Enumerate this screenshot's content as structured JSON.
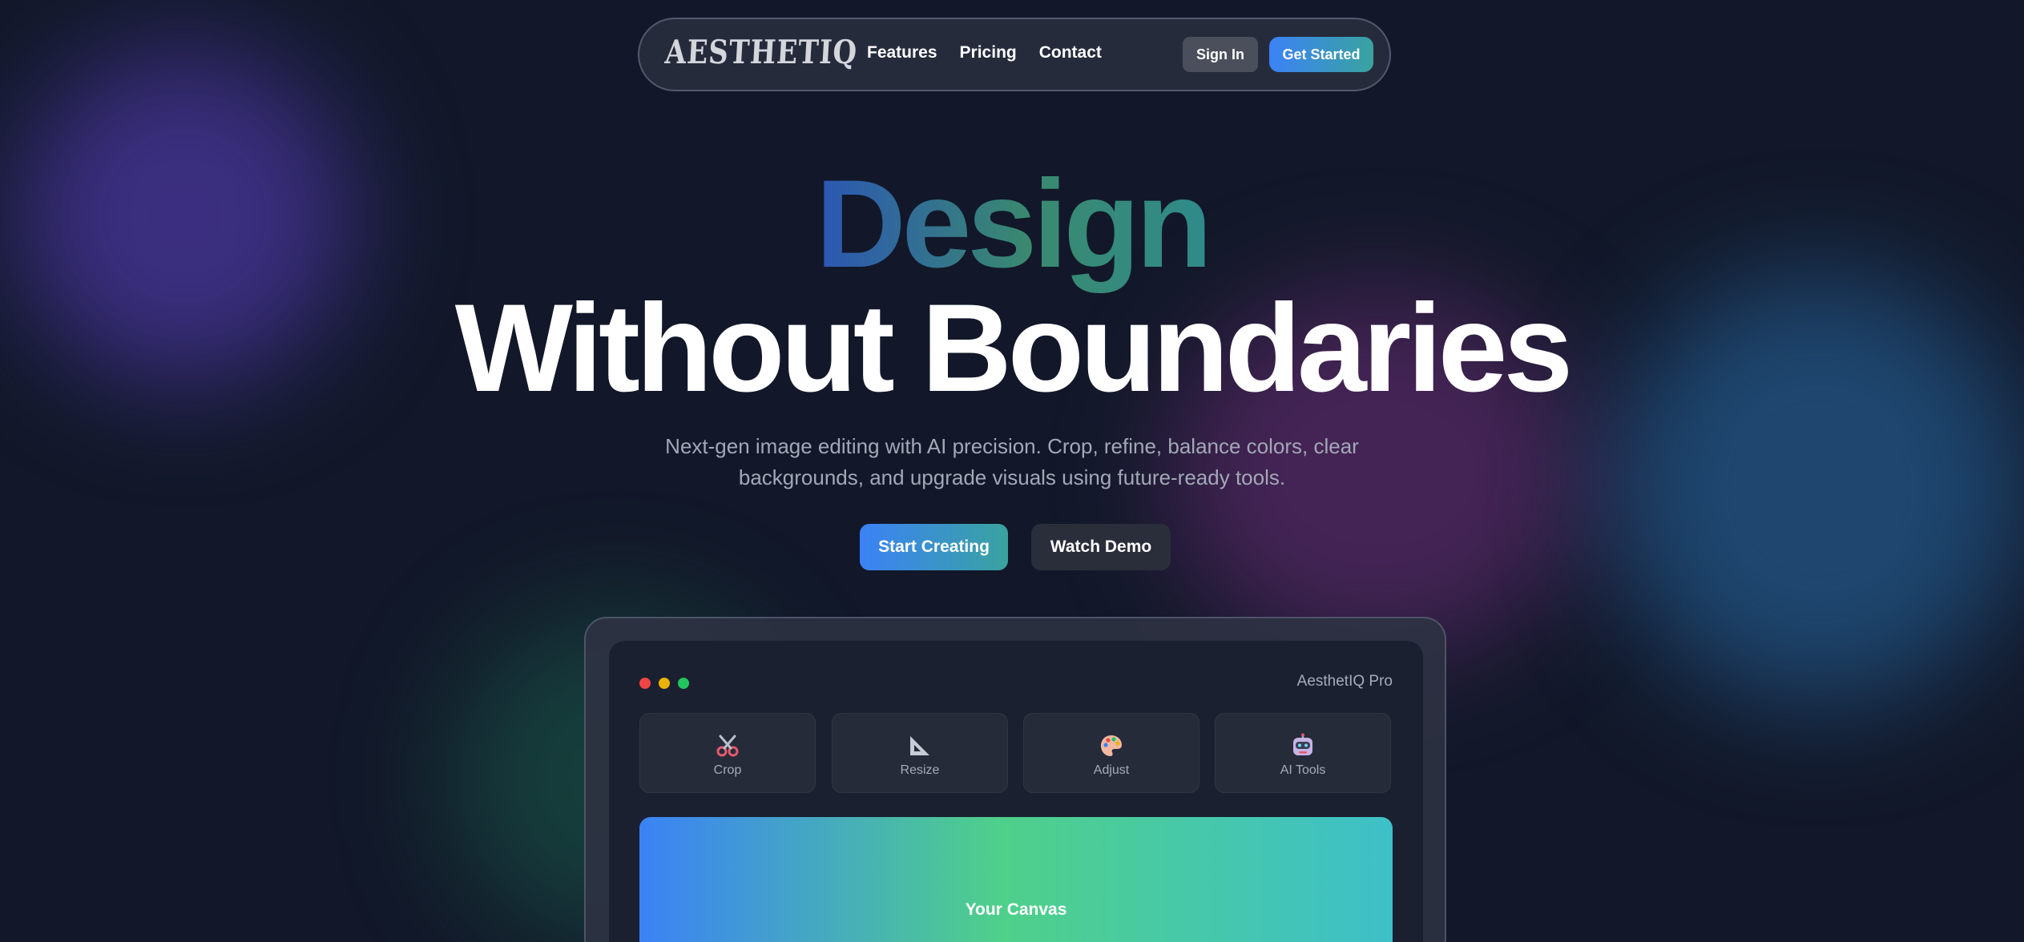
{
  "nav": {
    "logo": "AESTHETIQ",
    "links": [
      "Features",
      "Pricing",
      "Contact"
    ],
    "sign_in": "Sign In",
    "get_started": "Get Started"
  },
  "hero": {
    "title_line1": "Design",
    "title_line2": "Without Boundaries",
    "subtitle": "Next-gen image editing with AI precision. Crop, refine, balance colors, clear backgrounds, and upgrade visuals using future-ready tools.",
    "primary_cta": "Start Creating",
    "secondary_cta": "Watch Demo"
  },
  "app_preview": {
    "app_name": "AesthetIQ Pro",
    "tools": [
      {
        "label": "Crop",
        "icon": "scissors-icon"
      },
      {
        "label": "Resize",
        "icon": "set-square-icon"
      },
      {
        "label": "Adjust",
        "icon": "palette-icon"
      },
      {
        "label": "AI Tools",
        "icon": "robot-icon"
      }
    ],
    "canvas_label": "Your Canvas"
  },
  "colors": {
    "background": "#121829",
    "accent_blue": "#3b82f6",
    "accent_teal": "#3aa39f"
  }
}
